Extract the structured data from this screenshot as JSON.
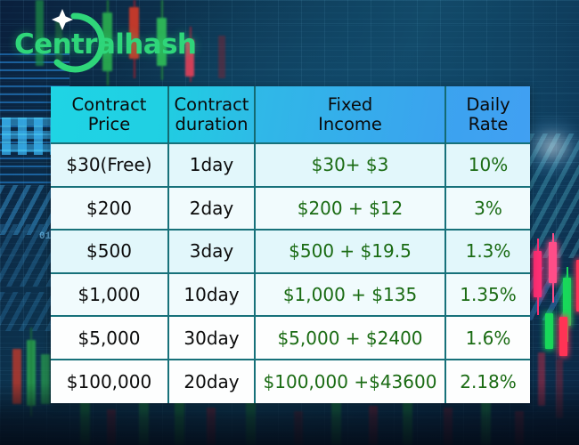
{
  "brand": {
    "name": "Centralhash",
    "logo_color": "#2fd67a",
    "star_icon": "sparkle-star-icon",
    "arc_icon": "circular-arc-icon"
  },
  "background": {
    "theme_color": "#0d3550",
    "accent_color": "#1fd4e4",
    "style": "crypto-candlestick-chart"
  },
  "table": {
    "headers": [
      "Contract\nPrice",
      "Contract\nduration",
      "Fixed\nIncome",
      "Daily\nRate"
    ],
    "header_lines": [
      [
        "Contract",
        "Price"
      ],
      [
        "Contract",
        "duration"
      ],
      [
        "Fixed",
        "Income"
      ],
      [
        "Daily",
        "Rate"
      ]
    ],
    "header_gradient_from": "#1fd4e4",
    "header_gradient_to": "#41a0f2",
    "border_color": "#17717a",
    "value_color": "#1a6b13",
    "label_color": "#0b0b0b",
    "rows": [
      {
        "contract_price": "$30(Free)",
        "contract_duration": "1day",
        "fixed_income": "$30+ $3",
        "daily_rate": "10%"
      },
      {
        "contract_price": "$200",
        "contract_duration": "2day",
        "fixed_income": "$200 + $12",
        "daily_rate": "3%"
      },
      {
        "contract_price": "$500",
        "contract_duration": "3day",
        "fixed_income": "$500 + $19.5",
        "daily_rate": "1.3%"
      },
      {
        "contract_price": "$1,000",
        "contract_duration": "10day",
        "fixed_income": "$1,000 + $135",
        "daily_rate": "1.35%"
      },
      {
        "contract_price": "$5,000",
        "contract_duration": "30day",
        "fixed_income": "$5,000 + $2400",
        "daily_rate": "1.6%"
      },
      {
        "contract_price": "$100,000",
        "contract_duration": "20day",
        "fixed_income": "$100,000 +$43600",
        "daily_rate": "2.18%"
      }
    ]
  }
}
